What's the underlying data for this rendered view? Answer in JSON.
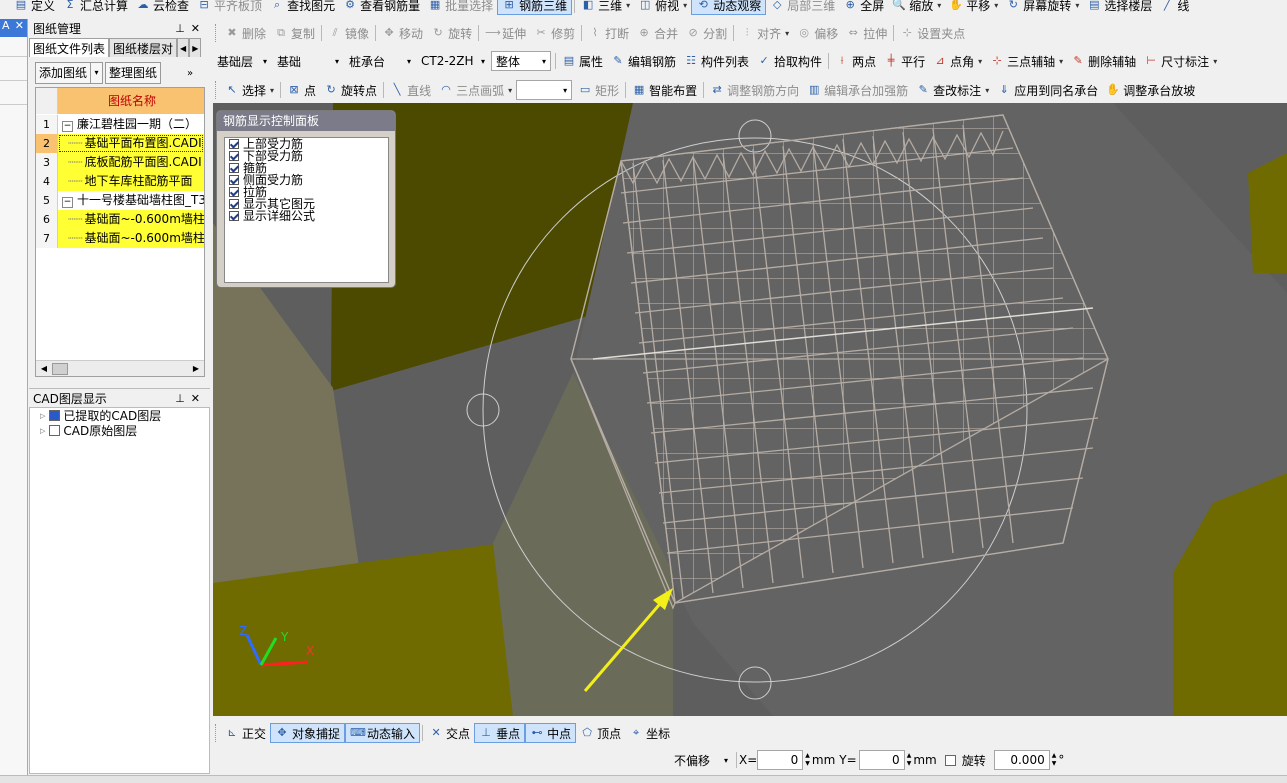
{
  "toolbar1": [
    {
      "label": "定义",
      "icon": "▤",
      "disabled": false
    },
    {
      "label": "汇总计算",
      "icon": "Σ",
      "disabled": false
    },
    {
      "label": "云检查",
      "icon": "☁",
      "disabled": false
    },
    {
      "label": "平齐板顶",
      "icon": "⊟",
      "disabled": true
    },
    {
      "label": "查找图元",
      "icon": "⌕",
      "disabled": false
    },
    {
      "label": "查看钢筋量",
      "icon": "⚙",
      "disabled": false
    },
    {
      "label": "批量选择",
      "icon": "▦",
      "disabled": true
    },
    {
      "label": "钢筋三维",
      "icon": "⊞",
      "disabled": false,
      "active": true
    },
    {
      "label": "三维",
      "icon": "◧",
      "disabled": false,
      "dropdown": true
    },
    {
      "label": "俯视",
      "icon": "◫",
      "disabled": false,
      "dropdown": true
    },
    {
      "label": "动态观察",
      "icon": "⟲",
      "disabled": false,
      "active": true
    },
    {
      "label": "局部三维",
      "icon": "◇",
      "disabled": true
    },
    {
      "label": "全屏",
      "icon": "⊕",
      "disabled": false
    },
    {
      "label": "缩放",
      "icon": "🔍",
      "disabled": false,
      "dropdown": true
    },
    {
      "label": "平移",
      "icon": "✋",
      "disabled": false,
      "dropdown": true
    },
    {
      "label": "屏幕旋转",
      "icon": "↻",
      "disabled": false,
      "dropdown": true
    },
    {
      "label": "选择楼层",
      "icon": "▤",
      "disabled": false
    },
    {
      "label": "线",
      "icon": "╱",
      "disabled": false
    }
  ],
  "left_panel": {
    "title": "图纸管理",
    "tabs": [
      "图纸文件列表",
      "图纸楼层对"
    ],
    "add_label": "添加图纸",
    "tidy_label": "整理图纸",
    "column_header": "图纸名称",
    "rows": [
      {
        "num": "1",
        "label": "廉江碧桂园一期（二）",
        "group": true
      },
      {
        "num": "2",
        "label": "基础平面布置图.CADI",
        "highlight": true,
        "selected": true
      },
      {
        "num": "3",
        "label": "底板配筋平面图.CADI",
        "highlight": true
      },
      {
        "num": "4",
        "label": "地下车库柱配筋平面",
        "highlight": true
      },
      {
        "num": "5",
        "label": "十一号楼基础墙柱图_T3",
        "group": true
      },
      {
        "num": "6",
        "label": "基础面~-0.600m墙柱",
        "highlight": true
      },
      {
        "num": "7",
        "label": "基础面~-0.600m墙柱",
        "highlight": true
      }
    ]
  },
  "cad_panel": {
    "title": "CAD图层显示",
    "items": [
      {
        "label": "已提取的CAD图层",
        "checked": true
      },
      {
        "label": "CAD原始图层",
        "checked": false
      }
    ]
  },
  "toolbar2": [
    "删除",
    "复制",
    "镜像",
    "移动",
    "旋转",
    "延伸",
    "修剪",
    "打断",
    "合并",
    "分割",
    "对齐",
    "偏移",
    "拉伸",
    "设置夹点"
  ],
  "toolbar3": {
    "combos": [
      "基础层",
      "基础",
      "桩承台",
      "CT2-2ZH",
      "整体"
    ],
    "buttons": [
      "属性",
      "编辑钢筋",
      "构件列表",
      "拾取构件",
      "两点",
      "平行",
      "点角",
      "三点辅轴",
      "删除辅轴",
      "尺寸标注"
    ]
  },
  "toolbar4": [
    "选择",
    "点",
    "旋转点",
    "直线",
    "三点画弧",
    "矩形",
    "智能布置",
    "调整钢筋方向",
    "编辑承台加强筋",
    "查改标注",
    "应用到同名承台",
    "调整承台放坡"
  ],
  "rebar_panel": {
    "title": "钢筋显示控制面板",
    "items": [
      "上部受力筋",
      "下部受力筋",
      "箍筋",
      "侧面受力筋",
      "拉筋",
      "显示其它图元",
      "显示详细公式"
    ]
  },
  "snap_bar": [
    "正交",
    "对象捕捉",
    "动态输入",
    "交点",
    "垂点",
    "中点",
    "顶点",
    "坐标"
  ],
  "coord_bar": {
    "offset": "不偏移",
    "x_label": "X=",
    "x_value": "0",
    "x_unit": "mm",
    "y_label": "Y=",
    "y_value": "0",
    "y_unit": "mm",
    "rotate_label": "旋转",
    "rotate_value": "0.000",
    "rotate_unit": "°"
  },
  "axes": {
    "x": "X",
    "y": "Y",
    "z": "Z"
  },
  "colors": {
    "accent": "#3b78d8",
    "highlight_row": "#ffff33",
    "header_row": "#f8c271",
    "viewport_bg": "#5e5e5e",
    "olive": "#6f6b00",
    "rebar": "#b5aca4",
    "arrow": "#f2ef1a"
  }
}
